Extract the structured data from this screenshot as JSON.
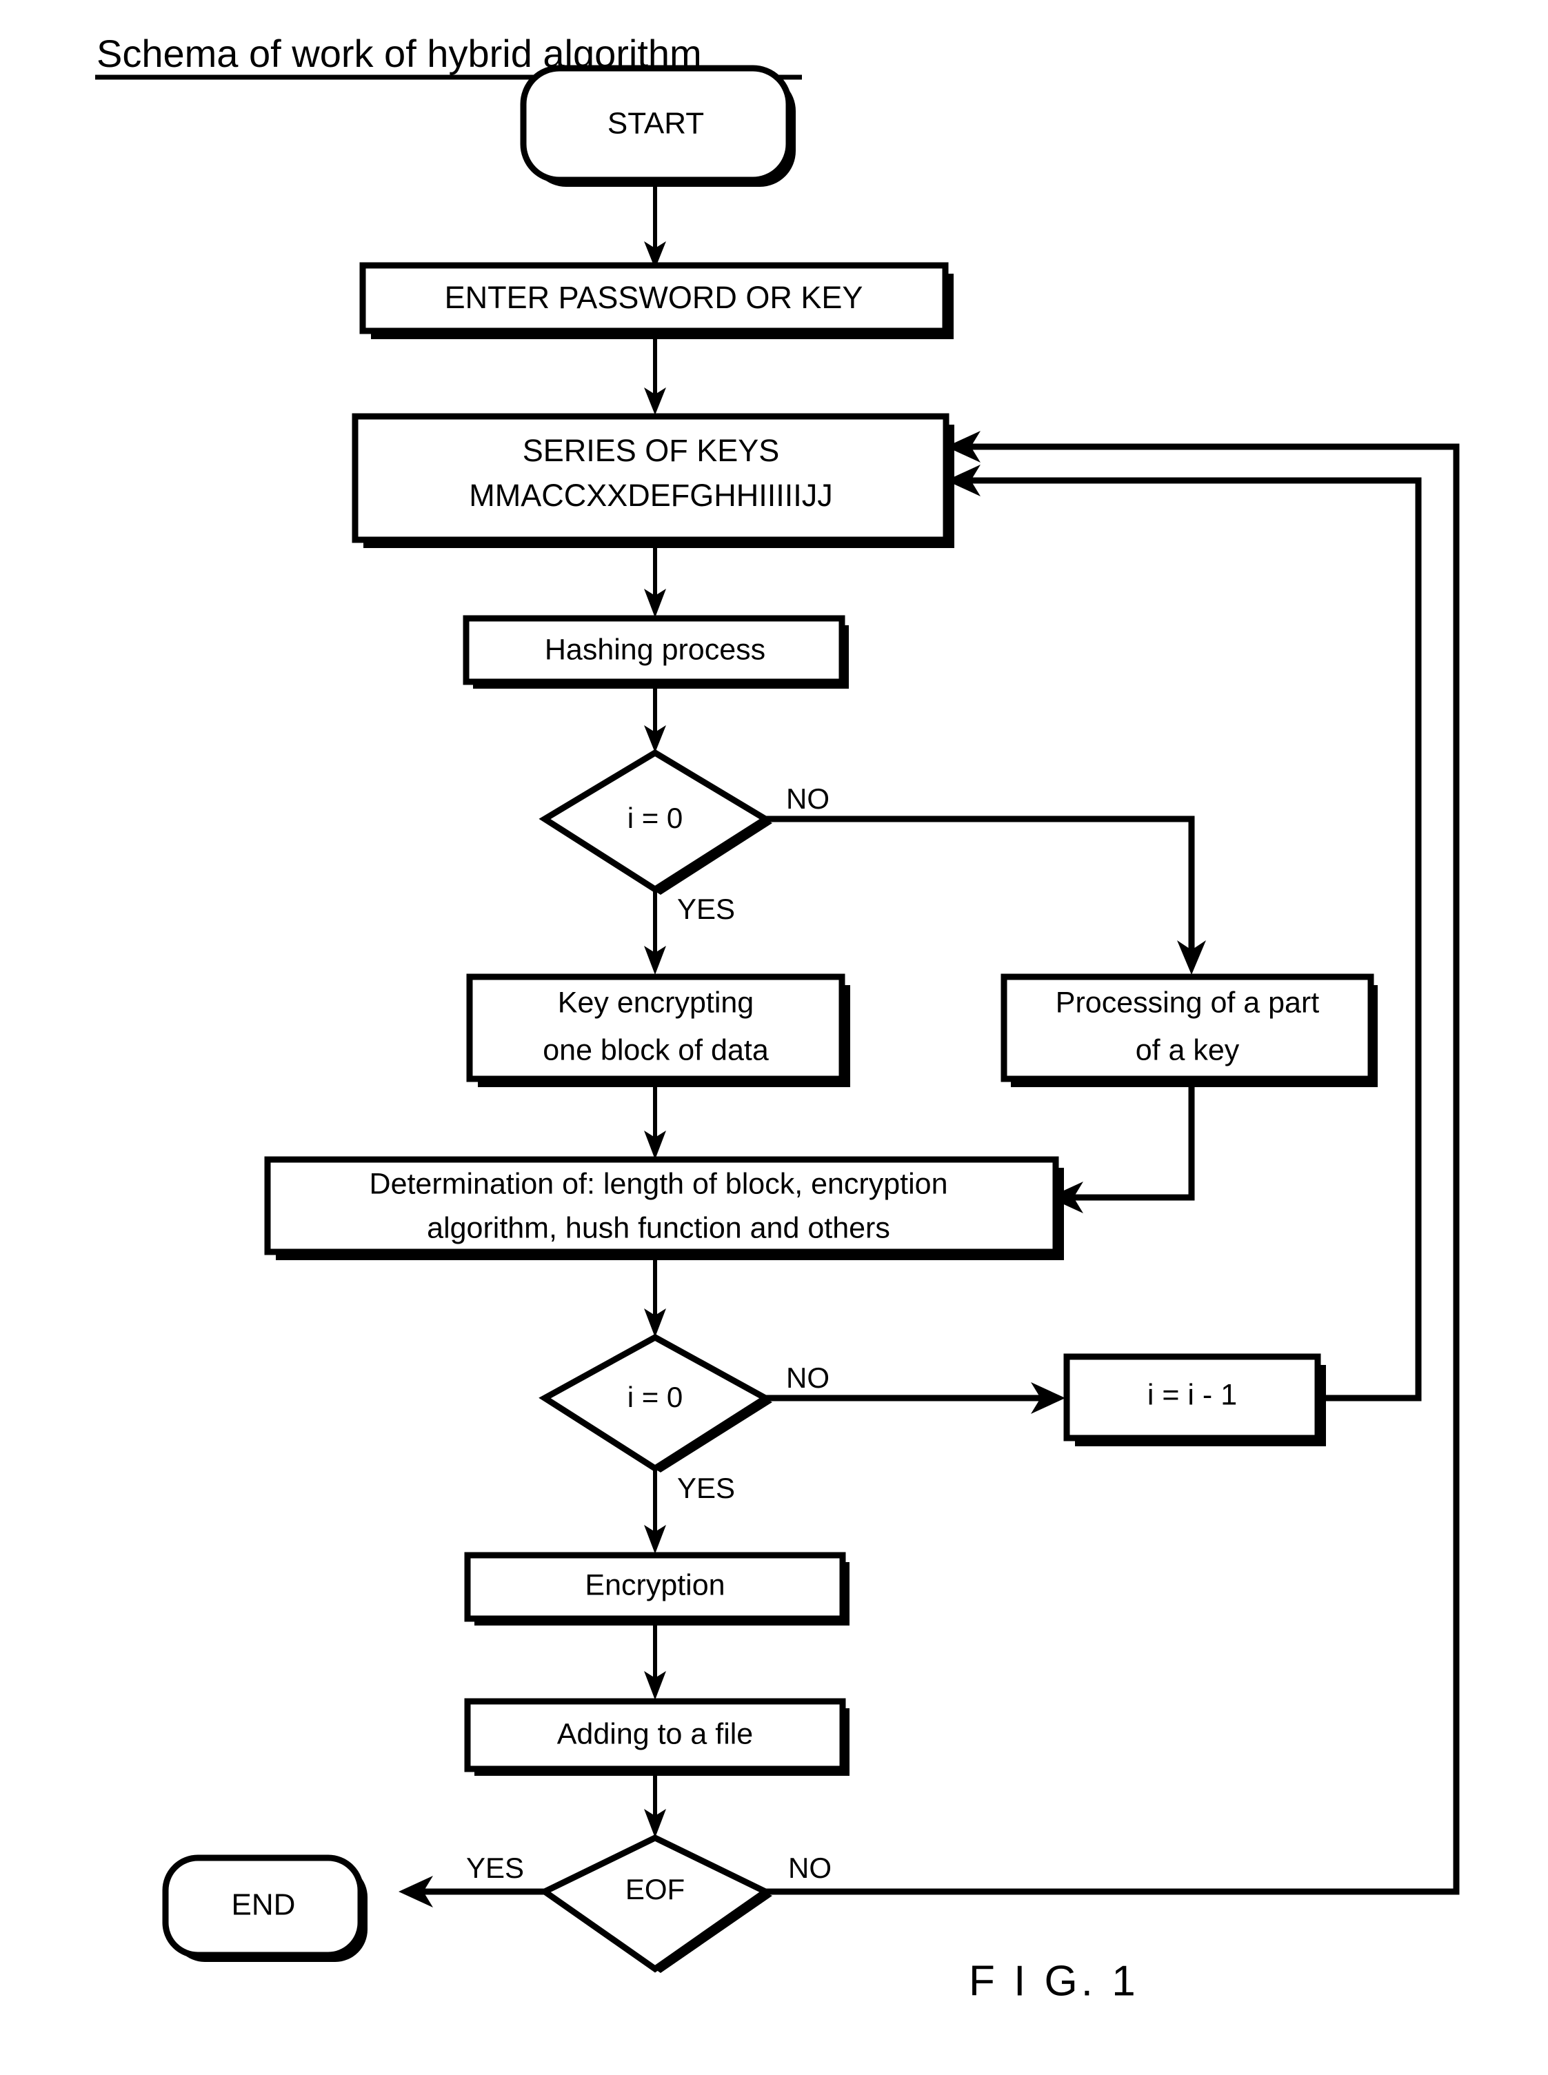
{
  "figure": {
    "title": "Schema of work of hybrid algorithm",
    "caption": "F I G. 1"
  },
  "nodes": {
    "start": {
      "label": "START",
      "shape": "terminator"
    },
    "enter_password": {
      "label": "ENTER PASSWORD OR KEY",
      "shape": "process"
    },
    "series_of_keys": {
      "line1": "SERIES OF KEYS",
      "line2": "MMACCXXDEFGHHIIIIIJJ",
      "shape": "process"
    },
    "hashing": {
      "label": "Hashing process",
      "shape": "process"
    },
    "decision_i0_top": {
      "label": "i = 0",
      "shape": "decision"
    },
    "key_encrypting": {
      "line1": "Key encrypting",
      "line2": "one block of data",
      "shape": "process"
    },
    "processing_part_key": {
      "line1": "Processing of a part",
      "line2": "of a key",
      "shape": "process"
    },
    "determination": {
      "line1": "Determination of: length of block, encryption",
      "line2": "algorithm, hush function and others",
      "shape": "process"
    },
    "decision_i0_bottom": {
      "label": "i = 0",
      "shape": "decision"
    },
    "decrement": {
      "label": "i = i - 1",
      "shape": "process"
    },
    "encryption": {
      "label": "Encryption",
      "shape": "process"
    },
    "adding_to_file": {
      "label": "Adding to a file",
      "shape": "process"
    },
    "decision_eof": {
      "label": "EOF",
      "shape": "decision"
    },
    "end": {
      "label": "END",
      "shape": "terminator"
    }
  },
  "branch_labels": {
    "top_no": "NO",
    "top_yes": "YES",
    "bottom_no": "NO",
    "bottom_yes": "YES",
    "eof_yes": "YES",
    "eof_no": "NO"
  },
  "colors": {
    "ink": "#000000",
    "paper": "#ffffff"
  }
}
